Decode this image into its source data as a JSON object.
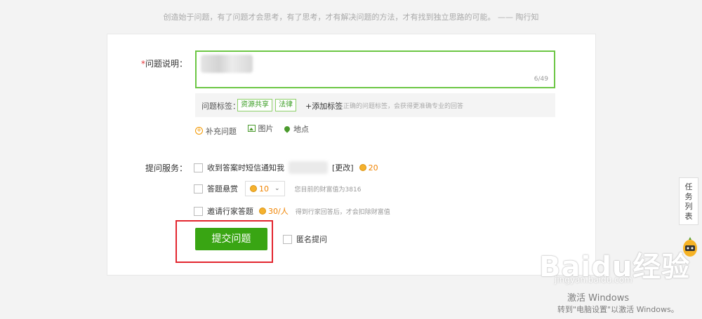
{
  "quote": "创造始于问题，有了问题才会思考，有了思考，才有解决问题的方法，才有找到独立思路的可能。 —— 陶行知",
  "form": {
    "question_label_req": "*",
    "question_label": "问题说明：",
    "char_count": "6/49",
    "tags_label": "问题标签：",
    "tags": [
      "资源共享",
      "法律"
    ],
    "add_tag": "+添加标签",
    "tag_tip": "正确的问题标签，会获得更准确专业的回答",
    "extras": {
      "supplement": "补充问题",
      "image": "图片",
      "location": "地点"
    },
    "service_label": "提问服务：",
    "sms_notify": "收到答案时短信通知我",
    "change": "[更改]",
    "sms_cost": "20",
    "bounty_label": "答题悬赏",
    "bounty_value": "10",
    "wealth_tip": "您目前的财富值为3816",
    "invite_label": "邀请行家答题",
    "invite_cost": "30/人",
    "invite_tip": "得到行家回答后，才会扣除财富值",
    "submit": "提交问题",
    "anonymous": "匿名提问"
  },
  "side_tab": [
    "任",
    "务",
    "列",
    "表"
  ],
  "watermark": {
    "brand": "Baidu经验",
    "url": "jingyan.baidu.com"
  },
  "activation": {
    "title": "激活 Windows",
    "subtitle": "转到\"电脑设置\"以激活 Windows。"
  },
  "colors": {
    "accent_green": "#39a513",
    "highlight_red": "#e3262f",
    "coin_orange": "#f08300"
  }
}
